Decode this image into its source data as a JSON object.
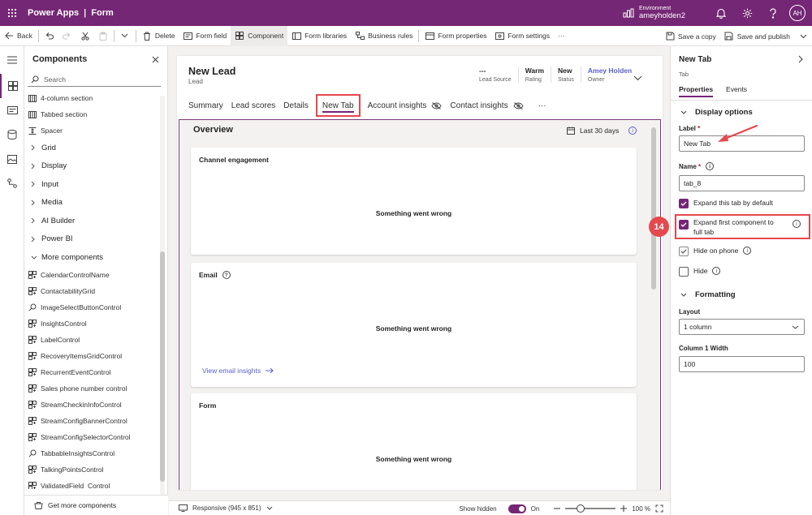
{
  "topbar": {
    "app_name": "Power Apps",
    "separator": "|",
    "section": "Form",
    "env_label": "Environment",
    "env_name": "ameyholden2",
    "avatar_initials": "AH",
    "color": "#742774"
  },
  "commands": {
    "back": "Back",
    "delete": "Delete",
    "form_field": "Form field",
    "component": "Component",
    "form_libraries": "Form libraries",
    "business_rules": "Business rules",
    "form_properties": "Form properties",
    "form_settings": "Form settings",
    "more": "···",
    "save_copy": "Save a copy",
    "save_publish": "Save and publish"
  },
  "components_panel": {
    "title": "Components",
    "search_placeholder": "Search",
    "items": [
      {
        "type": "item",
        "label": "4-column section",
        "icon": "section-icon"
      },
      {
        "type": "item",
        "label": "Tabbed section",
        "icon": "section-icon"
      },
      {
        "type": "item",
        "label": "Spacer",
        "icon": "spacer-icon"
      },
      {
        "type": "group",
        "label": "Grid",
        "expanded": false
      },
      {
        "type": "group",
        "label": "Display",
        "expanded": false
      },
      {
        "type": "group",
        "label": "Input",
        "expanded": false
      },
      {
        "type": "group",
        "label": "Media",
        "expanded": false
      },
      {
        "type": "group",
        "label": "AI Builder",
        "expanded": false
      },
      {
        "type": "group",
        "label": "Power BI",
        "expanded": false
      },
      {
        "type": "group",
        "label": "More components",
        "expanded": true
      },
      {
        "type": "item",
        "label": "CalendarControlName",
        "icon": "control-icon"
      },
      {
        "type": "item",
        "label": "ContactabilityGrid",
        "icon": "control-icon"
      },
      {
        "type": "item",
        "label": "ImageSelectButtonControl",
        "icon": "pin-icon"
      },
      {
        "type": "item",
        "label": "InsightsControl",
        "icon": "control-icon"
      },
      {
        "type": "item",
        "label": "LabelControl",
        "icon": "control-icon"
      },
      {
        "type": "item",
        "label": "RecoveryItemsGridControl",
        "icon": "control-icon"
      },
      {
        "type": "item",
        "label": "RecurrentEventControl",
        "icon": "control-icon"
      },
      {
        "type": "item",
        "label": "Sales phone number control",
        "icon": "control-icon"
      },
      {
        "type": "item",
        "label": "StreamCheckinInfoControl",
        "icon": "control-icon"
      },
      {
        "type": "item",
        "label": "StreamConfigBannerControl",
        "icon": "control-icon"
      },
      {
        "type": "item",
        "label": "StreamConfigSelectorControl",
        "icon": "control-icon"
      },
      {
        "type": "item",
        "label": "TabbableInsightsControl",
        "icon": "pin-icon"
      },
      {
        "type": "item",
        "label": "TalkingPointsControl",
        "icon": "control-icon"
      },
      {
        "type": "item",
        "label": "ValidatedField_Control",
        "icon": "control-icon"
      }
    ],
    "get_more": "Get more components"
  },
  "form": {
    "title": "New Lead",
    "type": "Lead",
    "header_fields": [
      {
        "value": "---",
        "label": "Lead Source",
        "link": false
      },
      {
        "value": "Warm",
        "label": "Rating",
        "link": false
      },
      {
        "value": "New",
        "label": "Status",
        "link": false
      },
      {
        "value": "Amey Holden",
        "label": "Owner",
        "link": true
      }
    ],
    "tabs": [
      {
        "label": "Summary",
        "selected": false,
        "hidden": false
      },
      {
        "label": "Lead scores",
        "selected": false,
        "hidden": false
      },
      {
        "label": "Details",
        "selected": false,
        "hidden": false
      },
      {
        "label": "New Tab",
        "selected": true,
        "hidden": false
      },
      {
        "label": "Account insights",
        "selected": false,
        "hidden": true
      },
      {
        "label": "Contact insights",
        "selected": false,
        "hidden": true
      }
    ],
    "tabs_more": "···",
    "section_title": "Overview",
    "date_filter": "Last 30 days",
    "cards": [
      {
        "title": "Channel engagement",
        "message": "Something went wrong",
        "has_help": false,
        "link": ""
      },
      {
        "title": "Email",
        "message": "Something went wrong",
        "has_help": true,
        "link": "View email insights"
      },
      {
        "title": "Form",
        "message": "Something went wrong",
        "has_help": false,
        "link": ""
      }
    ]
  },
  "statusbar": {
    "layout": "Responsive (945 x 851)",
    "show_hidden": "Show hidden",
    "toggle_state": "On",
    "zoom": "100 %",
    "zoom_level": 0.3
  },
  "properties": {
    "title": "New Tab",
    "subtitle": "Tab",
    "tabs": [
      "Properties",
      "Events"
    ],
    "display_options": "Display options",
    "label_title": "Label",
    "label_value": "New Tab",
    "name_title": "Name",
    "name_value": "tab_8",
    "expand_tab": "Expand this tab by default",
    "expand_first": "Expand first component to full tab",
    "hide_phone": "Hide on phone",
    "hide": "Hide",
    "formatting": "Formatting",
    "layout_title": "Layout",
    "layout_value": "1 column",
    "col_width_title": "Column 1 Width",
    "col_width_value": "100",
    "step_number": "14",
    "highlight_color": "#e5484d"
  }
}
